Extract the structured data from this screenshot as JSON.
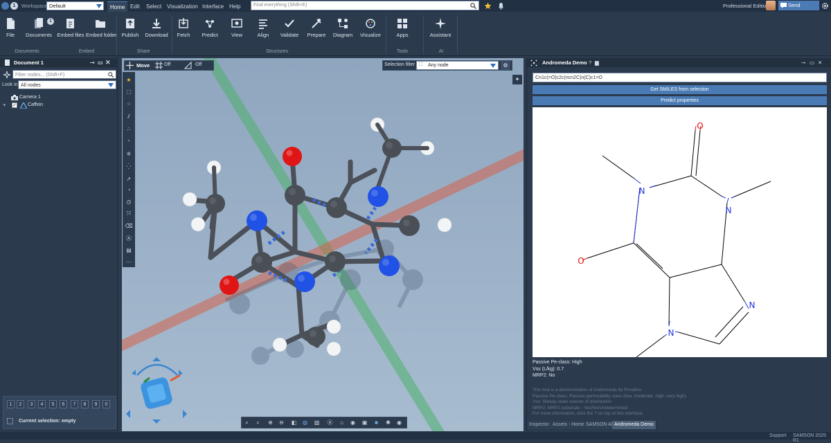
{
  "topbar": {
    "badge": "1",
    "workspace_label": "Workspace",
    "workspace_value": "Default",
    "menu": [
      "Home",
      "Edit",
      "Select",
      "Visualization",
      "Interface",
      "Help"
    ],
    "search_placeholder": "Find everything (Shift+E)",
    "edition": "Professional Edition",
    "feedback": "Send feedback"
  },
  "ribbon": {
    "buttons": [
      "File",
      "Documents",
      "Embed files",
      "Embed folder",
      "Publish",
      "Download",
      "Fetch",
      "Predict",
      "View",
      "Align",
      "Validate",
      "Prepare",
      "Diagram",
      "Visualize",
      "Apps",
      "Assistant"
    ],
    "documents_badge": "1",
    "groups": [
      "Documents",
      "Embed",
      "Share",
      "Structures",
      "Tools",
      "AI"
    ]
  },
  "left_panel": {
    "title": "Document 1",
    "filter_placeholder": "Filter nodes... (Shift+F)",
    "lookin_label": "Look in",
    "lookin_value": "All nodes",
    "nodes": [
      "Camera 1",
      "Caffein"
    ],
    "numkeys": [
      "1",
      "2",
      "3",
      "4",
      "5",
      "6",
      "7",
      "8",
      "9",
      "0"
    ],
    "selection_label": "Current selection: empty"
  },
  "viewport": {
    "mode": "Move",
    "grid_value": "Off",
    "snap_value": "Off",
    "selection_filter_label": "Selection filter",
    "selection_filter_value": "Any node"
  },
  "right_panel": {
    "title": "Andromeda Demo",
    "smiles": "Cn1c(=O)c2c(ncn2C)n(C)c1=O",
    "btn_get_smiles": "Get SMILES from selection",
    "btn_predict": "Predict properties",
    "atoms": {
      "o": "O",
      "n": "N"
    },
    "results": [
      "Passive Pe-class: High",
      "Vss (L/kg): 0.7",
      "MRP2: No"
    ],
    "info": [
      "This tool is a demonstration of Andromeda by Prosilico.",
      "Passive Pe-class: Passive permeability class (low, moderate, high, very high)",
      "Vss: Steady-state volume of distribution",
      "MRP2: MRP2 substrate - Yes/No/Undetermined",
      "For more information, click the ? on top of this interface."
    ],
    "tabs": [
      "Inspector",
      "Assets - Home",
      "SAMSON AI",
      "Andromeda Demo"
    ]
  },
  "statusbar": {
    "support": "Support",
    "version": "SAMSON 2025 R1"
  },
  "colors": {
    "accent": "#4a7bb5",
    "bg": "#2b3a4d",
    "viewport_bg": "#9fb5cc",
    "oxygen": "#e01010",
    "nitrogen": "#2a55e8",
    "carbon": "#555a60"
  }
}
